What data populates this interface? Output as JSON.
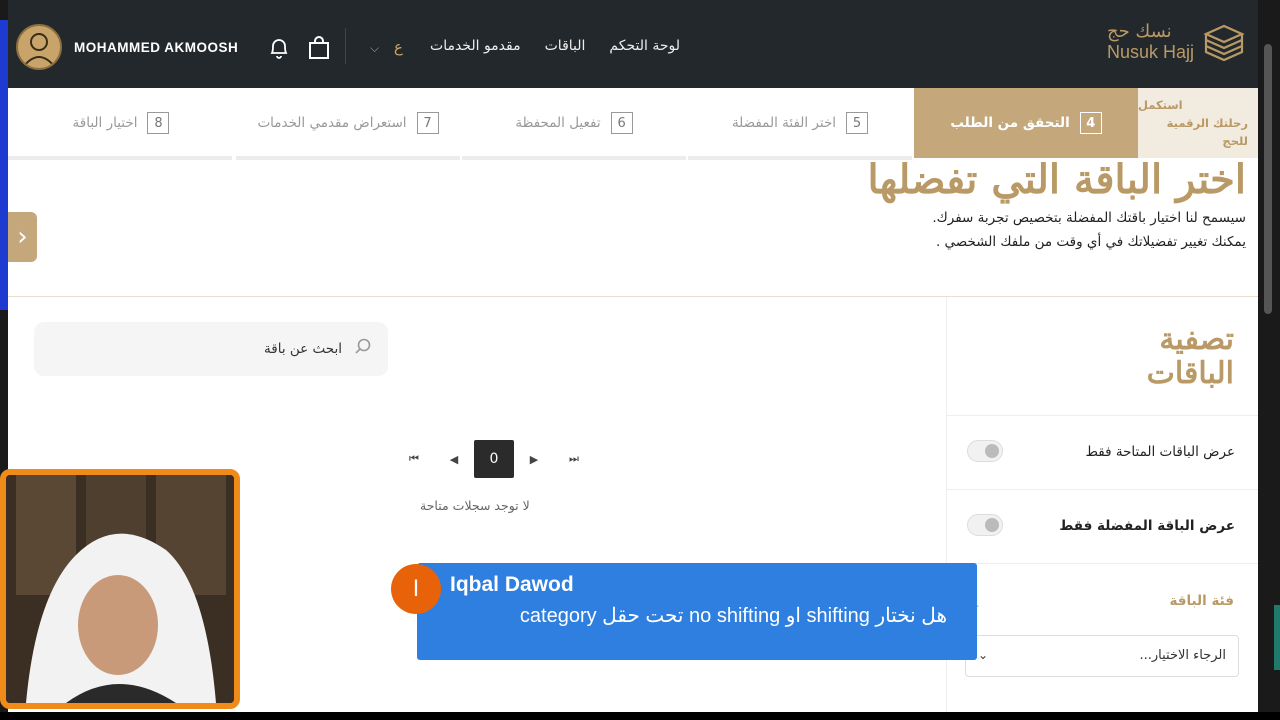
{
  "header": {
    "logo_ar": "نسك حج",
    "logo_en": "Nusuk Hajj",
    "nav": [
      "لوحة التحكم",
      "الباقات",
      "مقدمو الخدمات"
    ],
    "lang": "ع",
    "user_name": "MOHAMMED AKMOOSH"
  },
  "stepper": {
    "first_line1": "استكمل",
    "first_line2": "رحلتك الرقمية للحج",
    "steps": [
      {
        "num": "4",
        "label": "التحقق من الطلب",
        "active": true
      },
      {
        "num": "5",
        "label": "اختر الفئة المفضلة"
      },
      {
        "num": "6",
        "label": "تفعيل المحفظة"
      },
      {
        "num": "7",
        "label": "استعراض مقدمي الخدمات"
      },
      {
        "num": "8",
        "label": "اختيار الباقة"
      }
    ]
  },
  "hero": {
    "title": "اختر الباقة التي تفضلها",
    "line1": "سيسمح لنا اختيار باقتك المفضلة بتخصيص تجربة سفرك.",
    "line2": "يمكنك تغيير تفضيلاتك في أي وقت من ملفك الشخصي ."
  },
  "filter": {
    "title": "تصفية الباقات",
    "available_only": "عرض الباقات المتاحة فقط",
    "favorite_only": "عرض الباقة المفضلة فقط",
    "category_label": "فئة الباقة",
    "select_placeholder": "الرجاء الاختيار..."
  },
  "search": {
    "placeholder": "ابحث عن باقة"
  },
  "pager": {
    "current": "0"
  },
  "empty_text": "لا توجد سجلات متاحة",
  "chat": {
    "initial": "I",
    "name": "Iqbal Dawod",
    "message": "هل نختار shifting او no shifting تحت حقل category"
  },
  "colors": {
    "gold": "#b99a66",
    "header_bg": "#23282c",
    "chat_bg": "#2e7fe0",
    "badge": "#e8620a"
  }
}
